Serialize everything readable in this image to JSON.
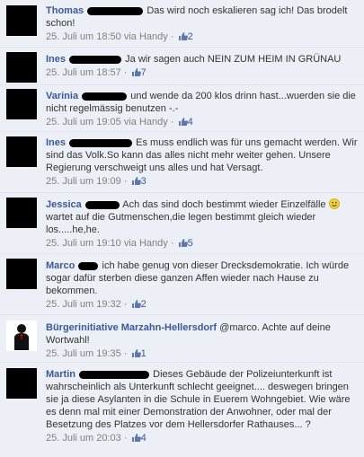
{
  "comments": [
    {
      "author": "Thomas",
      "text": "Das wird noch eskalieren sag ich! Das brodelt schon!",
      "date": "25. Juli um 18:50",
      "via": "via Handy",
      "sep": "·",
      "likes": "2"
    },
    {
      "author": "Ines",
      "text": "Ja wir sagen auch NEIN ZUM HEIM IN GRÜNAU",
      "date": "25. Juli um 18:57",
      "via": "",
      "sep": "·",
      "likes": "7"
    },
    {
      "author": "Varinia",
      "text": "und wende da 200 klos drinn hast...wuerden sie die nicht regelmässig benutzen -.-",
      "date": "25. Juli um 19:05",
      "via": "via Handy",
      "sep": "·",
      "likes": "4"
    },
    {
      "author": "Ines",
      "text": "Es muss endlich was für uns gemacht werden. Wir sind das Volk.So kann das alles nicht mehr weiter gehen. Unsere Regierung verschweigt uns alles und hat Versagt.",
      "date": "25. Juli um 19:09",
      "via": "",
      "sep": "·",
      "likes": "3"
    },
    {
      "author": "Jessica",
      "text": "Ach das sind doch bestimmt wieder Einzelfälle",
      "text2": "wartet auf die Gutmenschen,die legen bestimmt gleich wieder los.....he,he.",
      "date": "25. Juli um 19:10",
      "via": "via Handy",
      "sep": "·",
      "likes": "5"
    },
    {
      "author": "Marco",
      "text": "ich habe genug von dieser Drecksdemokratie. Ich würde sogar dafür sterben diese ganzen Affen wieder nach Hause zu bekommen.",
      "date": "25. Juli um 19:32",
      "via": "",
      "sep": "·",
      "likes": "2"
    },
    {
      "author": "Bürgerinitiative Marzahn-Hellersdorf",
      "text": "@marco. Achte auf deine Wortwahl!",
      "date": "25. Juli um 19:35",
      "via": "",
      "sep": "·",
      "likes": "1"
    },
    {
      "author": "Martin",
      "text": "Dieses Gebäude der Polizeiunterkunft ist wahrscheinlich als Unterkunft schlecht geeignet.... deswegen bringen sie ja diese Asylanten in die Schule in Euerem Wohngebiet. Wie wäre es denn mal mit einer Demonstration der Anwohner, oder mal der Besetzung des Platzes vor dem Hellersdorfer Rathauses... ?",
      "date": "25. Juli um 20:03",
      "via": "",
      "sep": "·",
      "likes": "4"
    }
  ]
}
